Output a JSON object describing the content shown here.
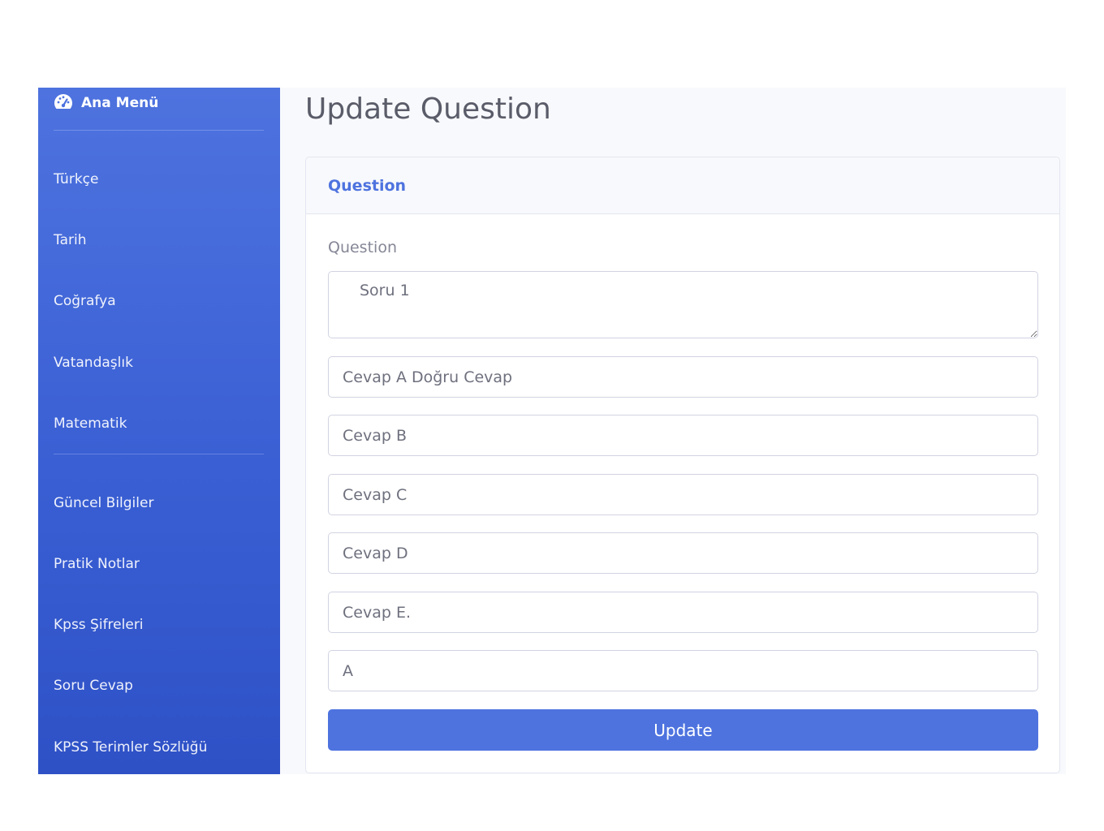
{
  "sidebar": {
    "brand": {
      "icon": "tachometer-icon",
      "label": "Ana Menü"
    },
    "items": [
      {
        "label": "Türkçe"
      },
      {
        "label": "Tarih"
      },
      {
        "label": "Coğrafya"
      },
      {
        "label": "Vatandaşlık"
      },
      {
        "label": "Matematik"
      },
      {
        "label": "Güncel Bilgiler"
      },
      {
        "label": "Pratik Notlar"
      },
      {
        "label": "Kpss Şifreleri"
      },
      {
        "label": "Soru Cevap"
      },
      {
        "label": "KPSS Terimler Sözlüğü"
      }
    ]
  },
  "main": {
    "title": "Update Question",
    "card": {
      "header": "Question",
      "question_label": "Question",
      "question_value": "Soru 1",
      "answers": [
        "Cevap A Doğru Cevap",
        "Cevap B",
        "Cevap C",
        "Cevap D",
        "Cevap E."
      ],
      "correct_answer": "A",
      "submit_label": "Update"
    }
  },
  "colors": {
    "primary": "#4e73df",
    "sidebar_dark": "#2e51c6",
    "text_muted": "#858796",
    "title": "#5a5c69"
  }
}
